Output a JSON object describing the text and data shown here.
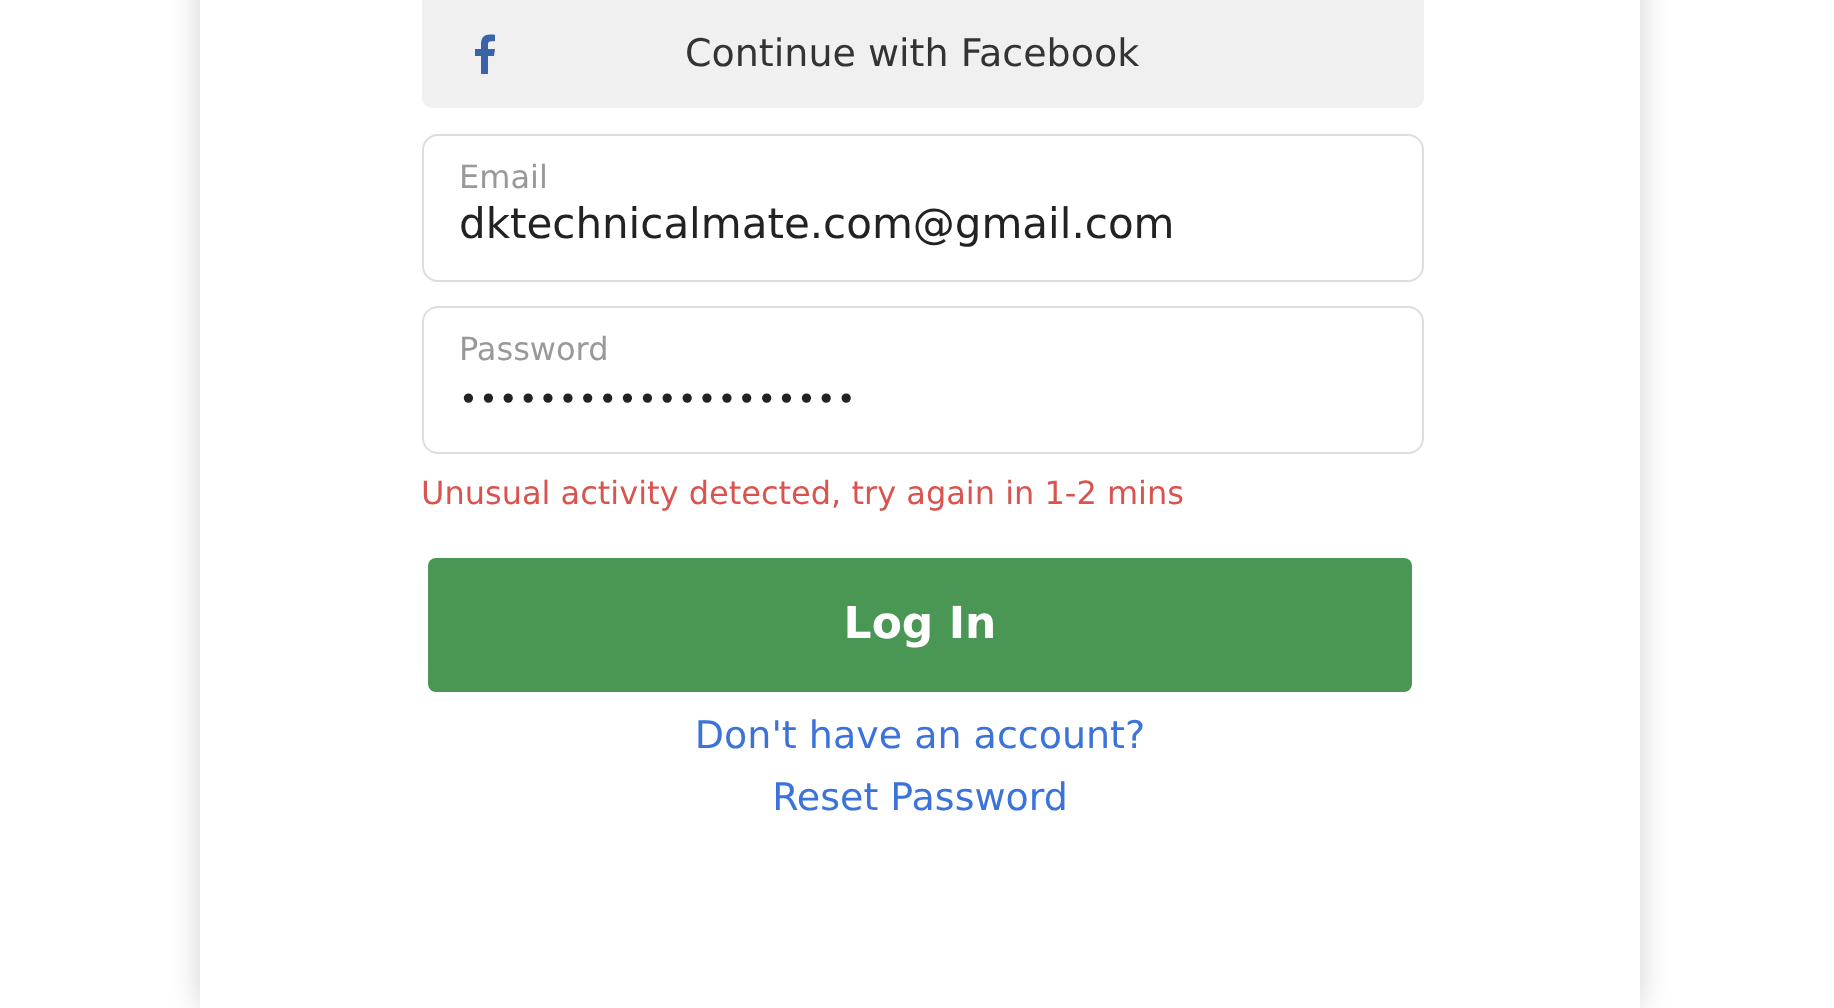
{
  "facebook_button": {
    "label": "Continue with Facebook"
  },
  "email": {
    "label": "Email",
    "value": "dktechnicalmate.com@gmail.com"
  },
  "password": {
    "label": "Password",
    "value": "••••••••••••••••••••"
  },
  "error": "Unusual activity detected, try again in 1-2 mins",
  "login_button": {
    "label": "Log In"
  },
  "links": [
    "Don't have an account?",
    "Reset Password"
  ]
}
